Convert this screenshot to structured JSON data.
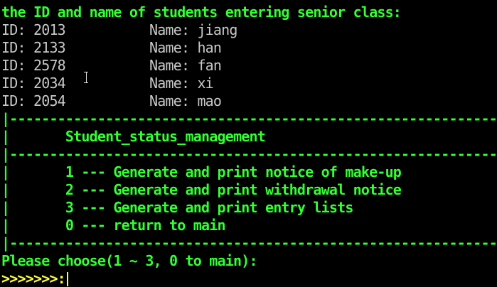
{
  "header": "the ID and name of students entering senior class:",
  "students": [
    {
      "id_label": "ID: 2013",
      "name_label": "Name: jiang"
    },
    {
      "id_label": "ID: 2133",
      "name_label": "Name: han"
    },
    {
      "id_label": "ID: 2578",
      "name_label": "Name: fan"
    },
    {
      "id_label": "ID: 2034",
      "name_label": "Name: xi"
    },
    {
      "id_label": "ID: 2054",
      "name_label": "Name: mao"
    }
  ],
  "menu": {
    "border_top": "|--------------------------------------------------------------------|",
    "title_row": "|       Student_status_management                                  |",
    "divider": "|--------------------------------------------------------------------|",
    "items": [
      "|       1 --- Generate and print notice of make-up                 |",
      "|       2 --- Generate and print withdrawal notice                 |",
      "|       3 --- Generate and print entry lists                       |",
      "|       0 --- return to main                                       |"
    ],
    "border_bottom": "|--------------------------------------------------------------------|"
  },
  "prompt": "Please choose(1 ~ 3, 0 to main):",
  "input_prompt": ">>>>>>>:",
  "colors": {
    "background": "#000000",
    "green": "#33ff33",
    "gray": "#c8c8c8",
    "yellow": "#ffff33"
  }
}
